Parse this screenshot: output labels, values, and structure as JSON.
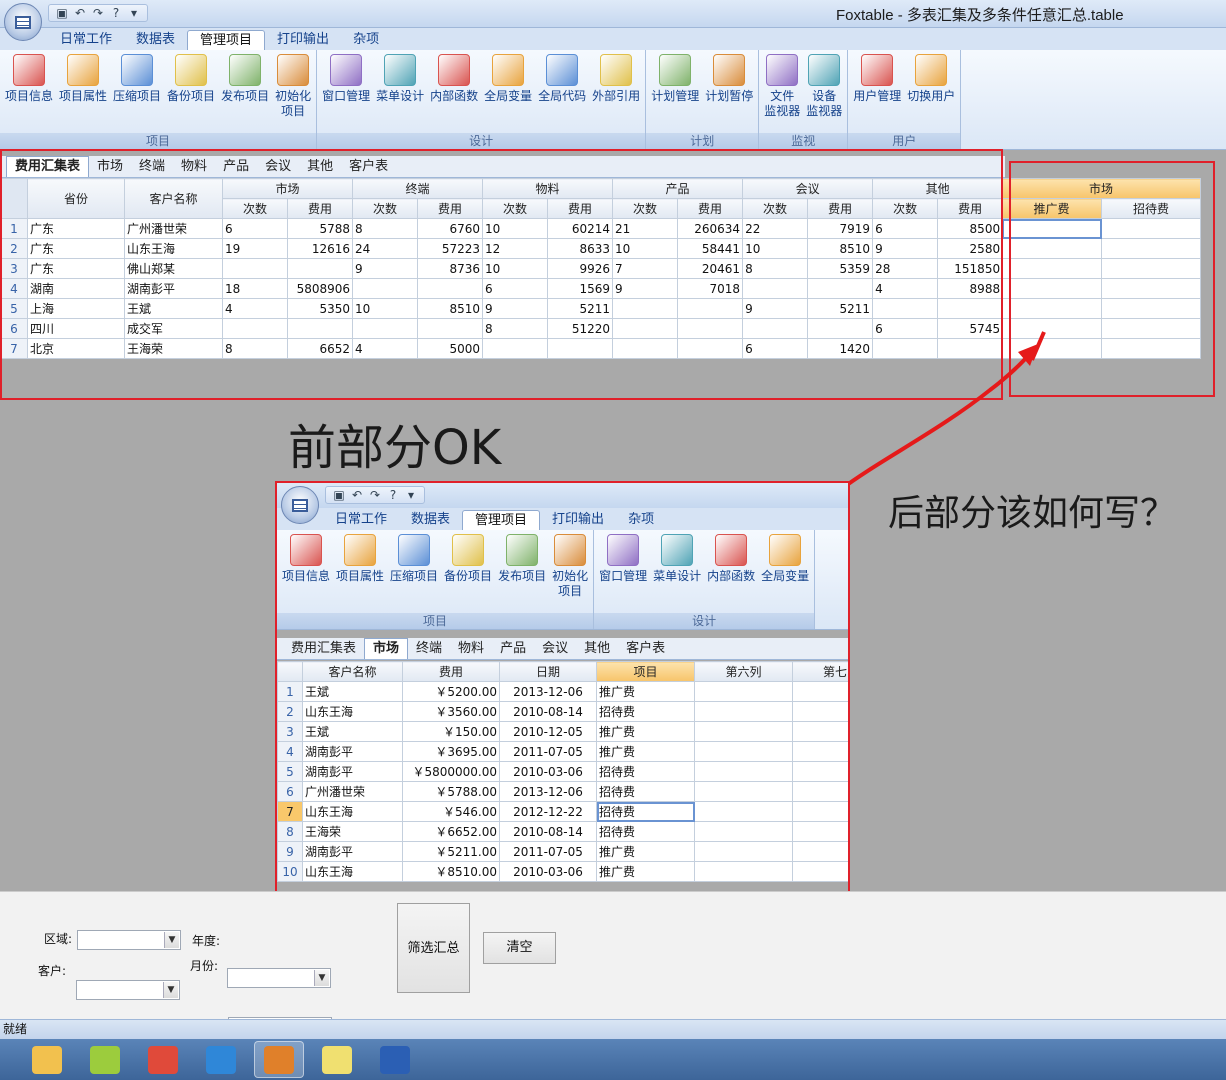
{
  "app": {
    "title": "Foxtable - 多表汇集及多条件任意汇总.table",
    "menu_tabs": [
      "日常工作",
      "数据表",
      "管理项目",
      "打印输出",
      "杂项"
    ],
    "active_tab": "管理项目"
  },
  "ribbon": {
    "groups": [
      {
        "label": "项目",
        "buttons": [
          "项目信息",
          "项目属性",
          "压缩项目",
          "备份项目",
          "发布项目",
          "初始化\n项目"
        ]
      },
      {
        "label": "设计",
        "buttons": [
          "窗口管理",
          "菜单设计",
          "内部函数",
          "全局变量",
          "全局代码",
          "外部引用"
        ]
      },
      {
        "label": "计划",
        "buttons": [
          "计划管理",
          "计划暂停"
        ]
      },
      {
        "label": "监视",
        "buttons": [
          "文件\n监视器",
          "设备\n监视器"
        ]
      },
      {
        "label": "用户",
        "buttons": [
          "用户管理",
          "切换用户"
        ]
      }
    ]
  },
  "sheet_tabs": [
    "费用汇集表",
    "市场",
    "终端",
    "物料",
    "产品",
    "会议",
    "其他",
    "客户表"
  ],
  "main_table": {
    "col_province": "省份",
    "col_customer": "客户名称",
    "groups": [
      "市场",
      "终端",
      "物料",
      "产品",
      "会议",
      "其他"
    ],
    "sub_count": "次数",
    "sub_fee": "费用",
    "rows": [
      {
        "n": "1",
        "province": "广东",
        "customer": "广州潘世荣",
        "v": [
          "6",
          "5788",
          "8",
          "6760",
          "10",
          "60214",
          "21",
          "260634",
          "22",
          "7919",
          "6",
          "8500"
        ]
      },
      {
        "n": "2",
        "province": "广东",
        "customer": "山东王海",
        "v": [
          "19",
          "12616",
          "24",
          "57223",
          "12",
          "8633",
          "10",
          "58441",
          "10",
          "8510",
          "9",
          "2580"
        ]
      },
      {
        "n": "3",
        "province": "广东",
        "customer": "佛山郑某",
        "v": [
          "",
          "",
          "9",
          "8736",
          "10",
          "9926",
          "7",
          "20461",
          "8",
          "5359",
          "28",
          "151850"
        ]
      },
      {
        "n": "4",
        "province": "湖南",
        "customer": "湖南彭平",
        "v": [
          "18",
          "5808906",
          "",
          "",
          "6",
          "1569",
          "9",
          "7018",
          "",
          "",
          "4",
          "8988"
        ]
      },
      {
        "n": "5",
        "province": "上海",
        "customer": "王斌",
        "v": [
          "4",
          "5350",
          "10",
          "8510",
          "9",
          "5211",
          "",
          "",
          "9",
          "5211",
          "",
          ""
        ]
      },
      {
        "n": "6",
        "province": "四川",
        "customer": "成交军",
        "v": [
          "",
          "",
          "",
          "",
          "8",
          "51220",
          "",
          "",
          "",
          "",
          "6",
          "5745"
        ]
      },
      {
        "n": "7",
        "province": "北京",
        "customer": "王海荣",
        "v": [
          "8",
          "6652",
          "4",
          "5000",
          "",
          "",
          "",
          "",
          "6",
          "1420",
          "",
          ""
        ]
      }
    ]
  },
  "extra_table": {
    "group": "市场",
    "cols": [
      "推广费",
      "招待费"
    ]
  },
  "annotations": {
    "left": "前部分OK",
    "right": "后部分该如何写？"
  },
  "inset": {
    "menu_tabs": [
      "日常工作",
      "数据表",
      "管理项目",
      "打印输出",
      "杂项"
    ],
    "active_tab": "管理项目",
    "groups": [
      {
        "label": "项目",
        "buttons": [
          "项目信息",
          "项目属性",
          "压缩项目",
          "备份项目",
          "发布项目",
          "初始化\n项目"
        ]
      },
      {
        "label": "设计",
        "buttons": [
          "窗口管理",
          "菜单设计",
          "内部函数",
          "全局变量"
        ]
      }
    ],
    "sheet_tabs": [
      "费用汇集表",
      "市场",
      "终端",
      "物料",
      "产品",
      "会议",
      "其他",
      "客户表"
    ],
    "active_sheet": "市场",
    "cols": [
      "客户名称",
      "费用",
      "日期",
      "项目",
      "第六列",
      "第七"
    ],
    "rows": [
      {
        "n": "1",
        "c": "王斌",
        "f": "￥5200.00",
        "d": "2013-12-06",
        "p": "推广费"
      },
      {
        "n": "2",
        "c": "山东王海",
        "f": "￥3560.00",
        "d": "2010-08-14",
        "p": "招待费"
      },
      {
        "n": "3",
        "c": "王斌",
        "f": "￥150.00",
        "d": "2010-12-05",
        "p": "推广费"
      },
      {
        "n": "4",
        "c": "湖南彭平",
        "f": "￥3695.00",
        "d": "2011-07-05",
        "p": "推广费"
      },
      {
        "n": "5",
        "c": "湖南彭平",
        "f": "￥5800000.00",
        "d": "2010-03-06",
        "p": "招待费"
      },
      {
        "n": "6",
        "c": "广州潘世荣",
        "f": "￥5788.00",
        "d": "2013-12-06",
        "p": "招待费"
      },
      {
        "n": "7",
        "c": "山东王海",
        "f": "￥546.00",
        "d": "2012-12-22",
        "p": "招待费"
      },
      {
        "n": "8",
        "c": "王海荣",
        "f": "￥6652.00",
        "d": "2010-08-14",
        "p": "招待费"
      },
      {
        "n": "9",
        "c": "湖南彭平",
        "f": "￥5211.00",
        "d": "2011-07-05",
        "p": "推广费"
      },
      {
        "n": "10",
        "c": "山东王海",
        "f": "￥8510.00",
        "d": "2010-03-06",
        "p": "推广费"
      }
    ]
  },
  "filter": {
    "region_label": "区域:",
    "customer_label": "客户:",
    "year_label": "年度:",
    "month_label": "月份:",
    "filter_button": "筛选汇总",
    "clear_button": "清空"
  },
  "status": "就绪",
  "taskbar": [
    "folder-icon",
    "hao123-icon",
    "chrome-icon",
    "ie-icon",
    "foxtable-icon",
    "help-icon",
    "word-icon"
  ]
}
